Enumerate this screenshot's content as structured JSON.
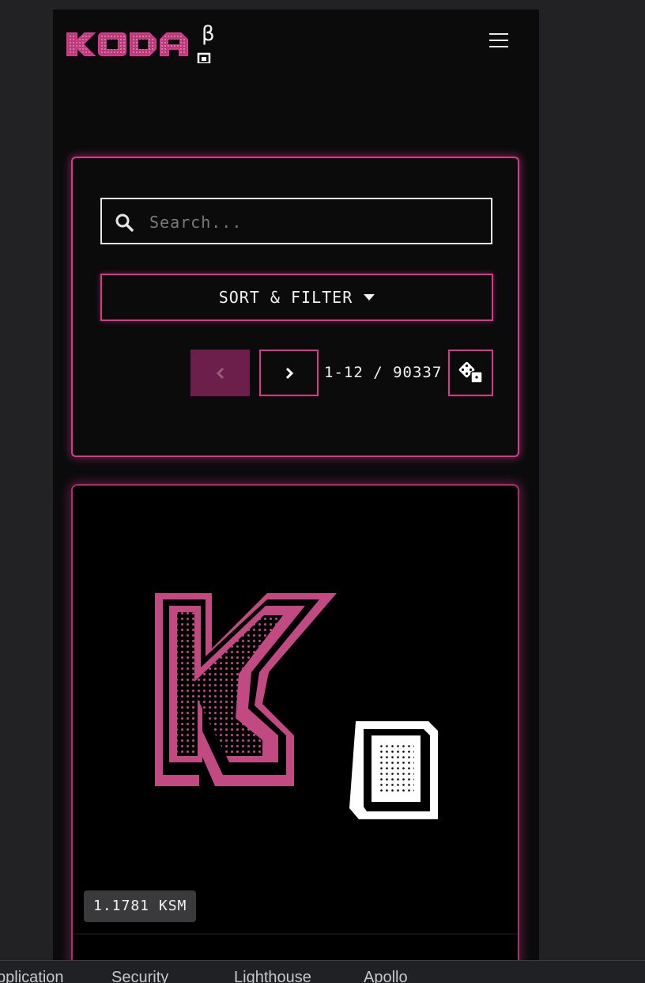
{
  "header": {
    "logo_text": "KODA",
    "logo_beta": "β"
  },
  "search": {
    "placeholder": "Search..."
  },
  "filter": {
    "sort_label": "SORT & FILTER"
  },
  "pagination": {
    "range": "1-12 / 90337"
  },
  "card": {
    "price": "1.1781 KSM"
  },
  "devtools": {
    "tabs": [
      "pplication",
      "Security",
      "Lighthouse",
      "Apollo"
    ]
  },
  "colors": {
    "accent": "#d63a8a",
    "accent_dark": "#6b1f4a",
    "background": "#0b0b0c"
  },
  "icons": {
    "search": "search-icon",
    "prev": "chevron-left-icon",
    "next": "chevron-right-icon",
    "random": "dice-icon",
    "menu": "hamburger-icon"
  }
}
